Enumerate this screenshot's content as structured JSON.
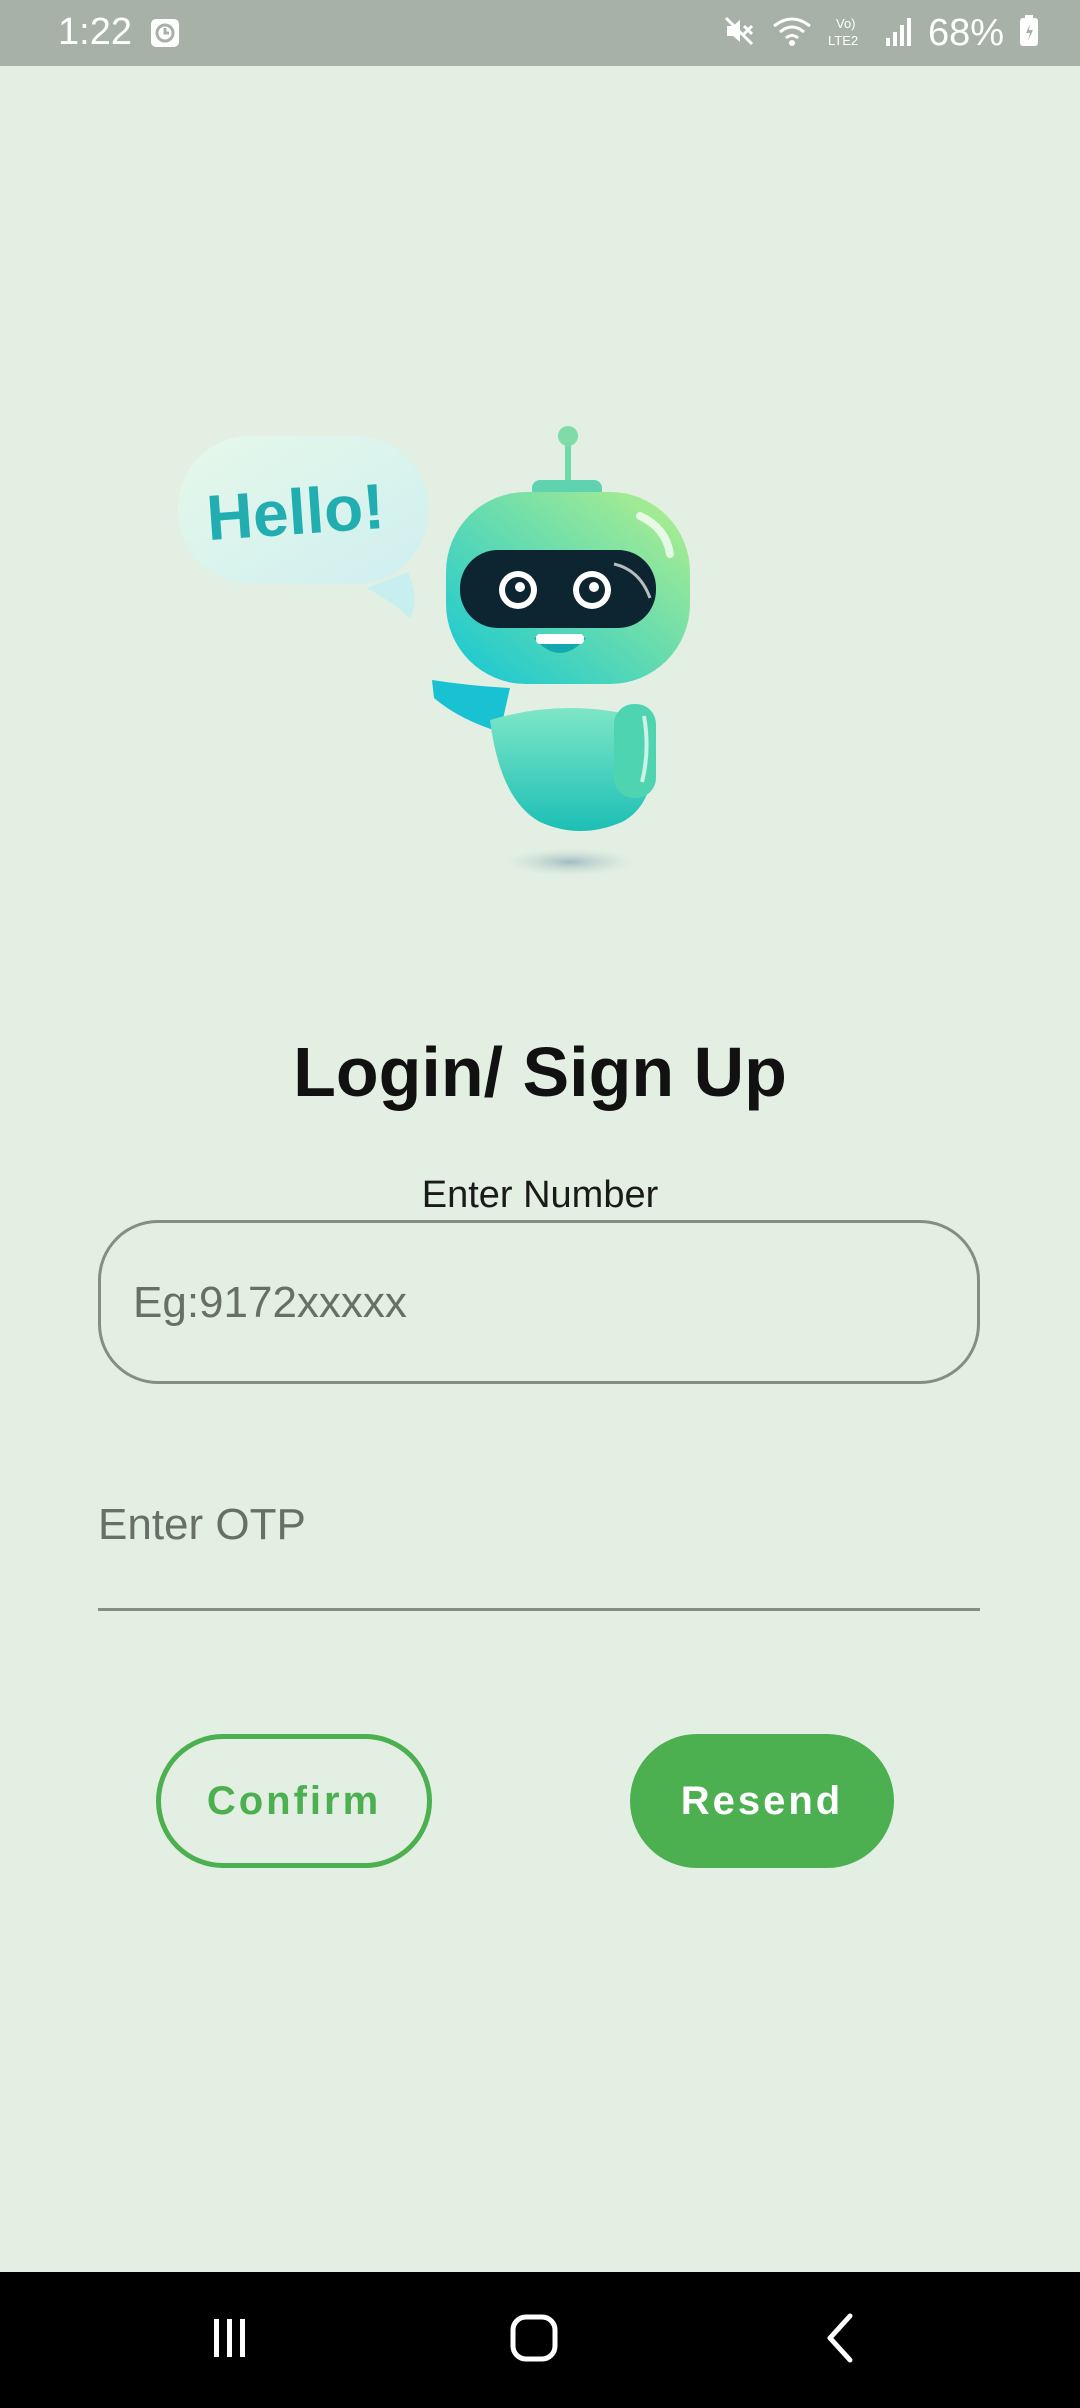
{
  "status_bar": {
    "time": "1:22",
    "battery": "68%",
    "icons": [
      "alarm-icon",
      "mute-icon",
      "wifi-icon",
      "volte-icon",
      "signal-icon",
      "battery-icon"
    ]
  },
  "illustration": {
    "bubble_text": "Hello!",
    "icon": "robot-illustration"
  },
  "login": {
    "title": "Login/ Sign Up",
    "number_label": "Enter Number",
    "number_placeholder": "Eg:9172xxxxx",
    "number_value": "",
    "otp_placeholder": "Enter OTP",
    "otp_value": "",
    "confirm_label": "Confirm",
    "resend_label": "Resend"
  },
  "colors": {
    "background": "#e3efe3",
    "accent": "#4caf50",
    "status_bar": "#a7b1a7",
    "nav_bar": "#000000"
  },
  "nav_bar": {
    "icons": [
      "recent-apps-icon",
      "home-icon",
      "back-icon"
    ]
  }
}
